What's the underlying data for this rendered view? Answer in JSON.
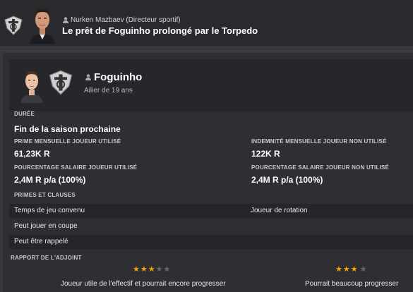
{
  "header": {
    "sender": "Nurken Mazbaev  (Directeur sportif)",
    "headline": "Le prêt de Foguinho prolongé par le Torpedo"
  },
  "player": {
    "name": "Foguinho",
    "subtitle": "Ailier de 19 ans"
  },
  "contract": {
    "duration_label": "DURÉE",
    "duration_value": "Fin de la saison prochaine",
    "used_fee_label": "PRIME MENSUELLE JOUEUR UTILISÉ",
    "used_fee_value": "61,23K R",
    "unused_fee_label": "INDEMNITÉ MENSUELLE JOUEUR NON UTILISÉ",
    "unused_fee_value": "122K R",
    "used_wage_label": "POURCENTAGE SALAIRE JOUEUR UTILISÉ",
    "used_wage_value": "2,4M R p/a (100%)",
    "unused_wage_label": "POURCENTAGE SALAIRE JOUEUR NON UTILISÉ",
    "unused_wage_value": "2,4M R p/a (100%)",
    "clauses_label": "PRIMES ET CLAUSES"
  },
  "clauses": [
    {
      "left": "Temps de jeu convenu",
      "right": "Joueur de rotation"
    },
    {
      "left": "Peut jouer en coupe",
      "right": ""
    },
    {
      "left": "Peut être rappelé",
      "right": ""
    }
  ],
  "report": {
    "label": "RAPPORT DE L'ADJOINT",
    "current_stars": 3,
    "current_text": "Joueur utile de l'effectif et pourrait encore progresser",
    "potential_stars": 3,
    "potential_text": "Pourrait beaucoup progresser"
  },
  "colors": {
    "star_on": "#f0a500",
    "star_off": "#6a6a6e",
    "background": "#3a3a3e"
  }
}
